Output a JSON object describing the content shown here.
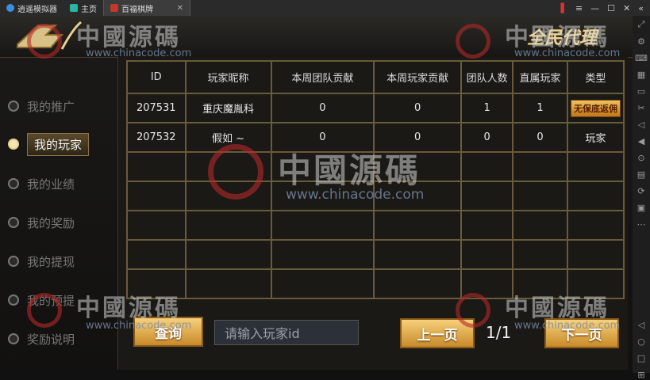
{
  "app": {
    "tabs": [
      {
        "label": "逍遥模拟器",
        "color": "#3a8fe0"
      },
      {
        "label": "主页",
        "color": "#2ab3a6"
      },
      {
        "label": "百福棋牌",
        "color": "#c0392b"
      }
    ]
  },
  "header": {
    "title": "全民代理"
  },
  "menu": {
    "items": [
      {
        "label": "我的推广"
      },
      {
        "label": "我的玩家"
      },
      {
        "label": "我的业绩"
      },
      {
        "label": "我的奖励"
      },
      {
        "label": "我的提现"
      },
      {
        "label": "我的预提"
      },
      {
        "label": "奖励说明"
      }
    ],
    "active_index": 1
  },
  "table": {
    "headers": [
      "ID",
      "玩家昵称",
      "本周团队贡献",
      "本周玩家贡献",
      "团队人数",
      "直属玩家",
      "类型"
    ],
    "rows": [
      {
        "id": "207531",
        "nickname": "重庆魔胤科",
        "team_contrib": "0",
        "player_contrib": "0",
        "team_size": "1",
        "direct": "1",
        "type": "无保底返佣"
      },
      {
        "id": "207532",
        "nickname": "假如 ~",
        "team_contrib": "0",
        "player_contrib": "0",
        "team_size": "0",
        "direct": "0",
        "type": "玩家"
      }
    ],
    "empty_rows": 5
  },
  "controls": {
    "query_label": "查询",
    "search_placeholder": "请输入玩家id",
    "prev_label": "上一页",
    "next_label": "下一页",
    "page": "1/1"
  },
  "watermark": {
    "text": "中國源碼",
    "url": "www.chinacode.com"
  }
}
